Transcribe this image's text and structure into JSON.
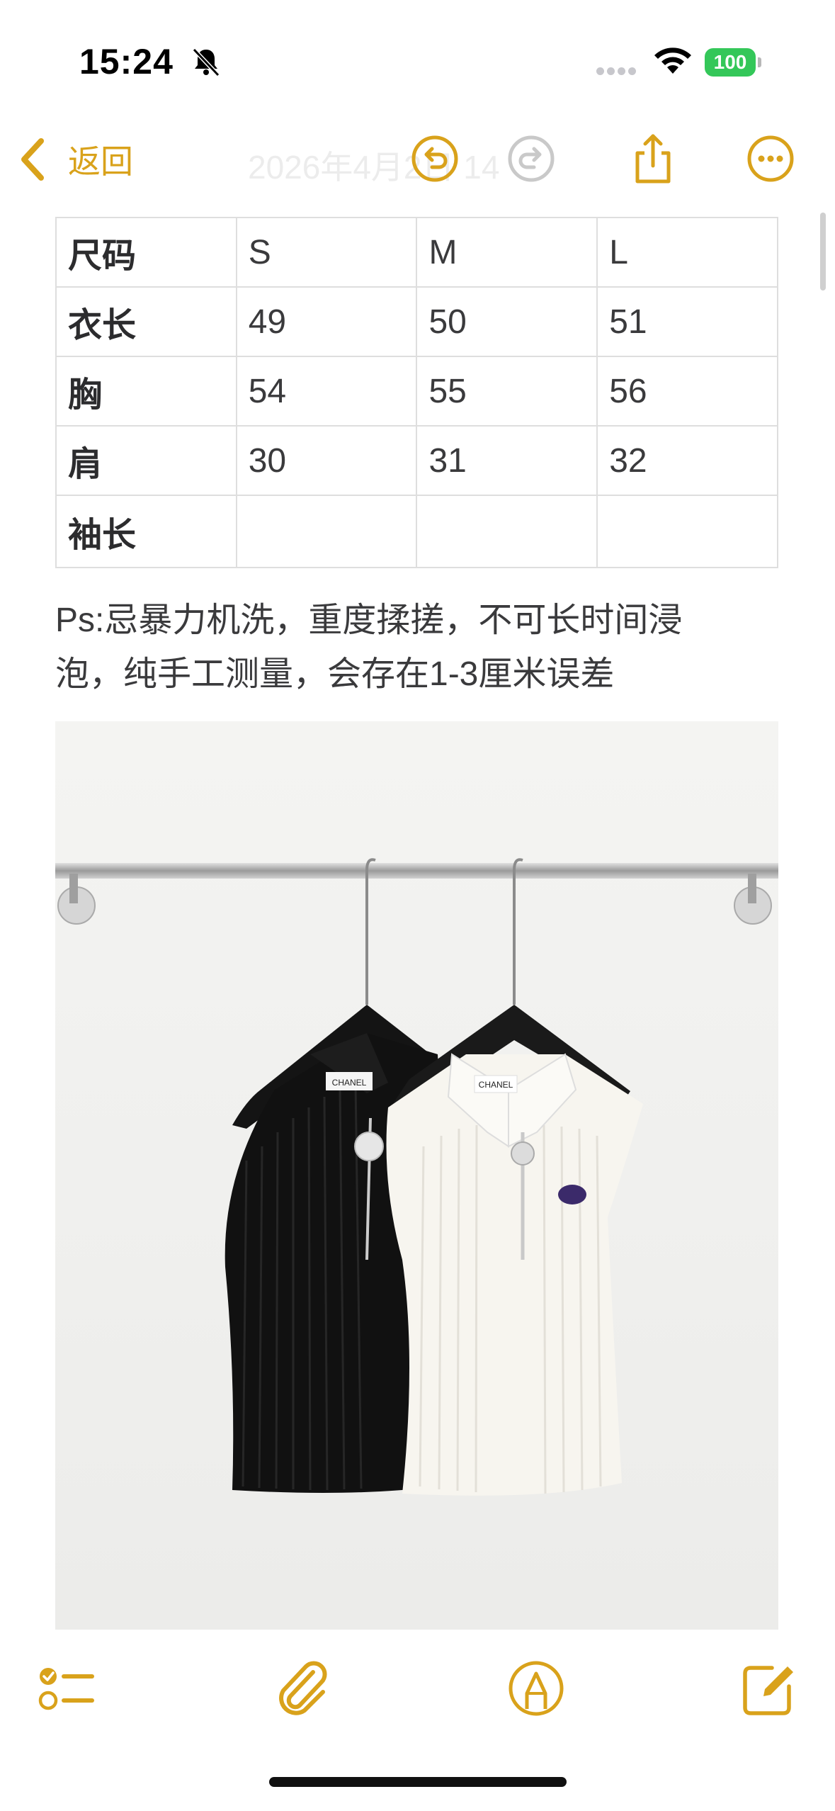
{
  "status_bar": {
    "time": "15:24",
    "battery": "100",
    "icons": [
      "bell-slash-icon",
      "signal-dots-icon",
      "wifi-icon",
      "battery-icon"
    ]
  },
  "nav": {
    "back_label": "返回",
    "title": "2026年4月2日 14",
    "icons": [
      "undo-icon",
      "redo-icon",
      "share-icon",
      "more-icon"
    ],
    "accent_color": "#d9a21b"
  },
  "size_table": {
    "header": [
      "尺码",
      "S",
      "M",
      "L"
    ],
    "rows": [
      [
        "衣长",
        "49",
        "50",
        "51"
      ],
      [
        "胸",
        "54",
        "55",
        "56"
      ],
      [
        "肩",
        "30",
        "31",
        "32"
      ],
      [
        "袖长",
        "",
        "",
        ""
      ]
    ]
  },
  "note": {
    "line1": "Ps:忌暴力机洗，重度揉搓，不可长时间浸",
    "line2": "泡，纯手工测量，会存在1-3厘米误差"
  },
  "photo": {
    "label_black": "CHANEL",
    "label_white": "CHANEL"
  },
  "toolbar": {
    "icons": [
      "checklist-icon",
      "paperclip-icon",
      "markup-pen-icon",
      "compose-icon"
    ]
  }
}
